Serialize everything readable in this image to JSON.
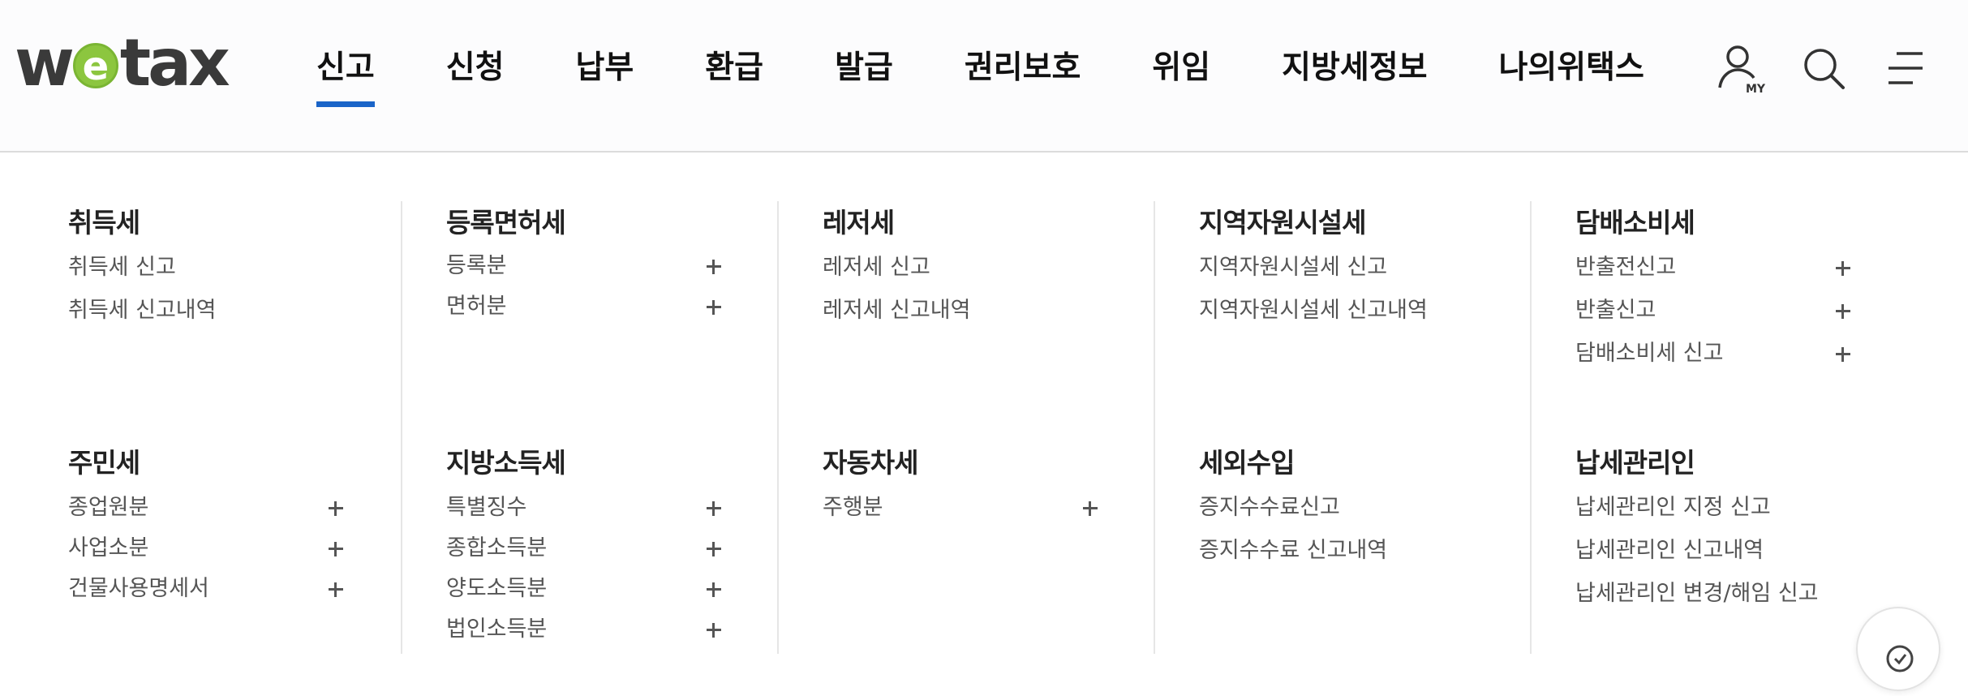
{
  "logo": {
    "w": "w",
    "e": "e",
    "tax": "tax"
  },
  "nav": {
    "items": [
      {
        "label": "신고",
        "active": true
      },
      {
        "label": "신청"
      },
      {
        "label": "납부"
      },
      {
        "label": "환급"
      },
      {
        "label": "발급"
      },
      {
        "label": "권리보호"
      },
      {
        "label": "위임"
      },
      {
        "label": "지방세정보"
      },
      {
        "label": "나의위택스"
      }
    ],
    "accent_color": "#1a64c8"
  },
  "header_icons": {
    "my": {
      "icon": "user-icon",
      "badge": "MY"
    },
    "search": {
      "icon": "search-icon"
    },
    "menu": {
      "icon": "menu-icon"
    }
  },
  "menu": {
    "columns": [
      {
        "groups": [
          {
            "title": "취득세",
            "items": [
              {
                "label": "취득세 신고"
              },
              {
                "label": "취득세 신고내역"
              }
            ]
          },
          {
            "title": "주민세",
            "items": [
              {
                "label": "종업원분",
                "expandable": true
              },
              {
                "label": "사업소분",
                "expandable": true
              },
              {
                "label": "건물사용명세서",
                "expandable": true
              }
            ]
          }
        ]
      },
      {
        "groups": [
          {
            "title": "등록면허세",
            "items": [
              {
                "label": "등록분",
                "expandable": true
              },
              {
                "label": "면허분",
                "expandable": true
              }
            ]
          },
          {
            "title": "지방소득세",
            "items": [
              {
                "label": "특별징수",
                "expandable": true
              },
              {
                "label": "종합소득분",
                "expandable": true
              },
              {
                "label": "양도소득분",
                "expandable": true
              },
              {
                "label": "법인소득분",
                "expandable": true
              }
            ]
          }
        ]
      },
      {
        "groups": [
          {
            "title": "레저세",
            "items": [
              {
                "label": "레저세 신고"
              },
              {
                "label": "레저세 신고내역"
              }
            ]
          },
          {
            "title": "자동차세",
            "items": [
              {
                "label": "주행분",
                "expandable": true
              }
            ]
          }
        ]
      },
      {
        "groups": [
          {
            "title": "지역자원시설세",
            "items": [
              {
                "label": "지역자원시설세 신고"
              },
              {
                "label": "지역자원시설세 신고내역"
              }
            ]
          },
          {
            "title": "세외수입",
            "items": [
              {
                "label": "증지수수료신고"
              },
              {
                "label": "증지수수료 신고내역"
              }
            ]
          }
        ]
      },
      {
        "groups": [
          {
            "title": "담배소비세",
            "items": [
              {
                "label": "반출전신고",
                "expandable": true
              },
              {
                "label": "반출신고",
                "expandable": true
              },
              {
                "label": "담배소비세 신고",
                "expandable": true
              }
            ]
          },
          {
            "title": "납세관리인",
            "items": [
              {
                "label": "납세관리인 지정 신고"
              },
              {
                "label": "납세관리인 신고내역"
              },
              {
                "label": "납세관리인 변경/해임 신고"
              }
            ]
          }
        ]
      }
    ]
  },
  "floating_button": {
    "icon": "clock-check-icon"
  }
}
